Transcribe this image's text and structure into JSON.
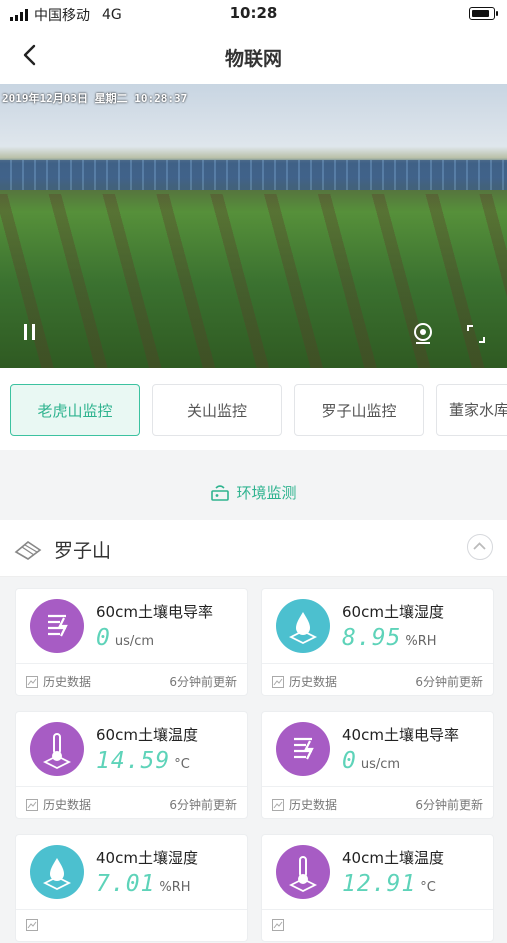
{
  "status": {
    "carrier": "中国移动",
    "network": "4G",
    "time": "10:28",
    "battery_level": 0.85
  },
  "nav": {
    "title": "物联网"
  },
  "video": {
    "osd": "2019年12月03日 星期二 10:28:37"
  },
  "tabs": [
    {
      "label": "老虎山监控",
      "active": true
    },
    {
      "label": "关山监控",
      "active": false
    },
    {
      "label": "罗子山监控",
      "active": false
    },
    {
      "label": "董家水库监控",
      "active": false
    }
  ],
  "env": {
    "label": "环境监测"
  },
  "section": {
    "name": "罗子山"
  },
  "cards": [
    {
      "label": "60cm土壤电导率",
      "value": "0",
      "unit": "us/cm",
      "icon": "conductivity-icon",
      "color": "#a75cc4",
      "history": "历史数据",
      "updated": "6分钟前更新"
    },
    {
      "label": "60cm土壤湿度",
      "value": "8.95",
      "unit": "%RH",
      "icon": "humidity-icon",
      "color": "#4cc0cf",
      "history": "历史数据",
      "updated": "6分钟前更新"
    },
    {
      "label": "60cm土壤温度",
      "value": "14.59",
      "unit": "°C",
      "icon": "thermometer-icon",
      "color": "#a75cc4",
      "history": "历史数据",
      "updated": "6分钟前更新"
    },
    {
      "label": "40cm土壤电导率",
      "value": "0",
      "unit": "us/cm",
      "icon": "conductivity-icon",
      "color": "#a75cc4",
      "history": "历史数据",
      "updated": "6分钟前更新"
    },
    {
      "label": "40cm土壤湿度",
      "value": "7.01",
      "unit": "%RH",
      "icon": "humidity-icon",
      "color": "#4cc0cf",
      "history": "",
      "updated": ""
    },
    {
      "label": "40cm土壤温度",
      "value": "12.91",
      "unit": "°C",
      "icon": "thermometer-icon",
      "color": "#a75cc4",
      "history": "",
      "updated": ""
    }
  ]
}
